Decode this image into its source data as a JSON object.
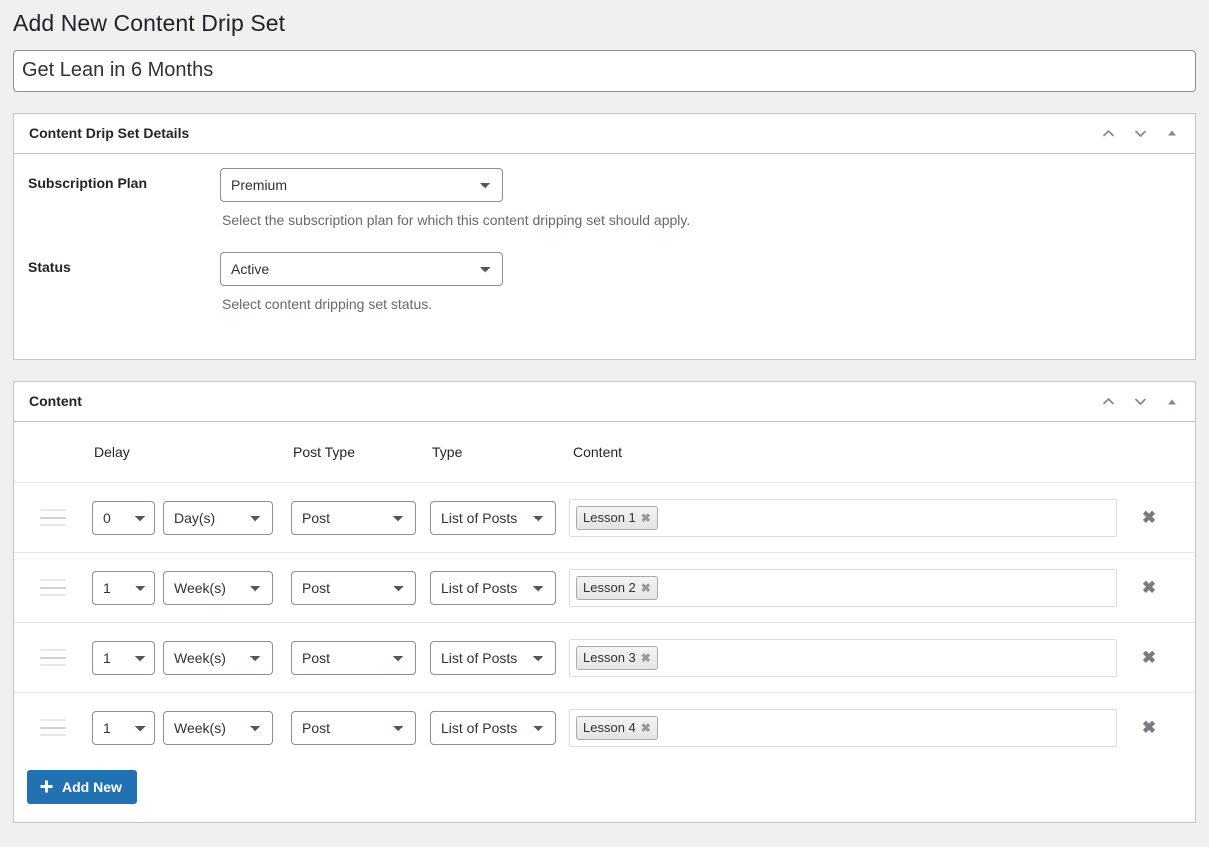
{
  "page": {
    "heading": "Add New Content Drip Set",
    "title_value": "Get Lean in 6 Months",
    "title_placeholder": "Enter title here"
  },
  "panel_actions": {
    "move_up": "chevron-up-icon",
    "move_down": "chevron-down-icon",
    "toggle": "triangle-up-icon"
  },
  "details_panel": {
    "title": "Content Drip Set Details",
    "fields": [
      {
        "label": "Subscription Plan",
        "value": "Premium",
        "options": [
          "Premium"
        ],
        "description": "Select the subscription plan for which this content dripping set should apply."
      },
      {
        "label": "Status",
        "value": "Active",
        "options": [
          "Active"
        ],
        "description": "Select content dripping set status."
      }
    ]
  },
  "content_panel": {
    "title": "Content",
    "columns": [
      "",
      "Delay",
      "Post Type",
      "Type",
      "Content",
      ""
    ],
    "rows": [
      {
        "delay_number": "0",
        "delay_unit": "Day(s)",
        "post_type": "Post",
        "type": "List of Posts",
        "tokens": [
          "Lesson 1"
        ]
      },
      {
        "delay_number": "1",
        "delay_unit": "Week(s)",
        "post_type": "Post",
        "type": "List of Posts",
        "tokens": [
          "Lesson 2"
        ]
      },
      {
        "delay_number": "1",
        "delay_unit": "Week(s)",
        "post_type": "Post",
        "type": "List of Posts",
        "tokens": [
          "Lesson 3"
        ]
      },
      {
        "delay_number": "1",
        "delay_unit": "Week(s)",
        "post_type": "Post",
        "type": "List of Posts",
        "tokens": [
          "Lesson 4"
        ]
      }
    ],
    "remove_label": "✖",
    "token_remove_label": "✖",
    "add_new_label": "Add New"
  },
  "colors": {
    "accent": "#2271b1",
    "page_background": "#f0f0f1",
    "panel_border": "#c3c4c7",
    "text": "#1d2327",
    "muted_text": "#646970"
  }
}
